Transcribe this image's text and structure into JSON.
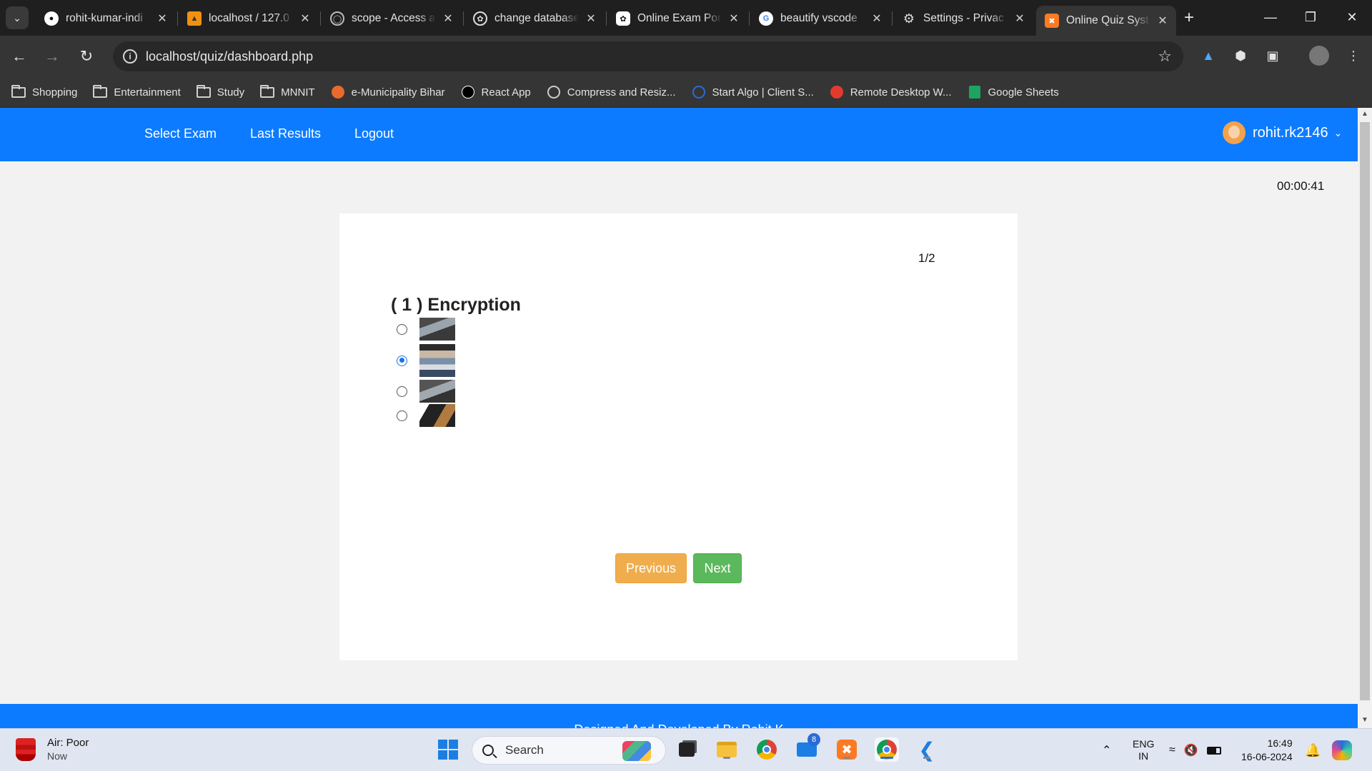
{
  "browser": {
    "tabs": [
      {
        "title": "rohit-kumar-indi",
        "icon": "github-icon"
      },
      {
        "title": "localhost / 127.0",
        "icon": "phpmyadmin-icon"
      },
      {
        "title": "scope - Access a",
        "icon": "globe-icon"
      },
      {
        "title": "change database",
        "icon": "openai-icon"
      },
      {
        "title": "Online Exam Por",
        "icon": "openai-icon"
      },
      {
        "title": "beautify vscode",
        "icon": "google-icon"
      },
      {
        "title": "Settings - Privac",
        "icon": "gear-icon"
      },
      {
        "title": "Online Quiz Syst",
        "icon": "xampp-icon",
        "active": true
      }
    ],
    "url": "localhost/quiz/dashboard.php",
    "bookmarks": [
      {
        "label": "Shopping",
        "icon": "folder-icon"
      },
      {
        "label": "Entertainment",
        "icon": "folder-icon"
      },
      {
        "label": "Study",
        "icon": "folder-icon"
      },
      {
        "label": "MNNIT",
        "icon": "folder-icon"
      },
      {
        "label": "e-Municipality Bihar",
        "icon": "municipality-icon"
      },
      {
        "label": "React App",
        "icon": "react-icon"
      },
      {
        "label": "Compress and Resiz...",
        "icon": "compress-icon"
      },
      {
        "label": "Start Algo | Client S...",
        "icon": "startalgo-icon"
      },
      {
        "label": "Remote Desktop W...",
        "icon": "remote-desktop-icon"
      },
      {
        "label": "Google Sheets",
        "icon": "sheets-icon"
      }
    ]
  },
  "page": {
    "nav": {
      "select_exam": "Select Exam",
      "last_results": "Last Results",
      "logout": "Logout",
      "username": "rohit.rk2146"
    },
    "timer": "00:00:41",
    "counter": "1/2",
    "question": "( 1 ) Encryption",
    "options": [
      {
        "checked": false
      },
      {
        "checked": true
      },
      {
        "checked": false
      },
      {
        "checked": false
      }
    ],
    "buttons": {
      "previous": "Previous",
      "next": "Next"
    },
    "footer_text": "Designed And Developed By Rohit K"
  },
  "taskbar": {
    "weather_title": "Air: Poor",
    "weather_sub": "Now",
    "search_placeholder": "Search",
    "mail_badge": "8",
    "lang_line1": "ENG",
    "lang_line2": "IN",
    "time": "16:49",
    "date": "16-06-2024"
  },
  "colors": {
    "brand_blue": "#0d7bff",
    "previous_button": "#f0ad4e",
    "next_button": "#5cb85c"
  }
}
